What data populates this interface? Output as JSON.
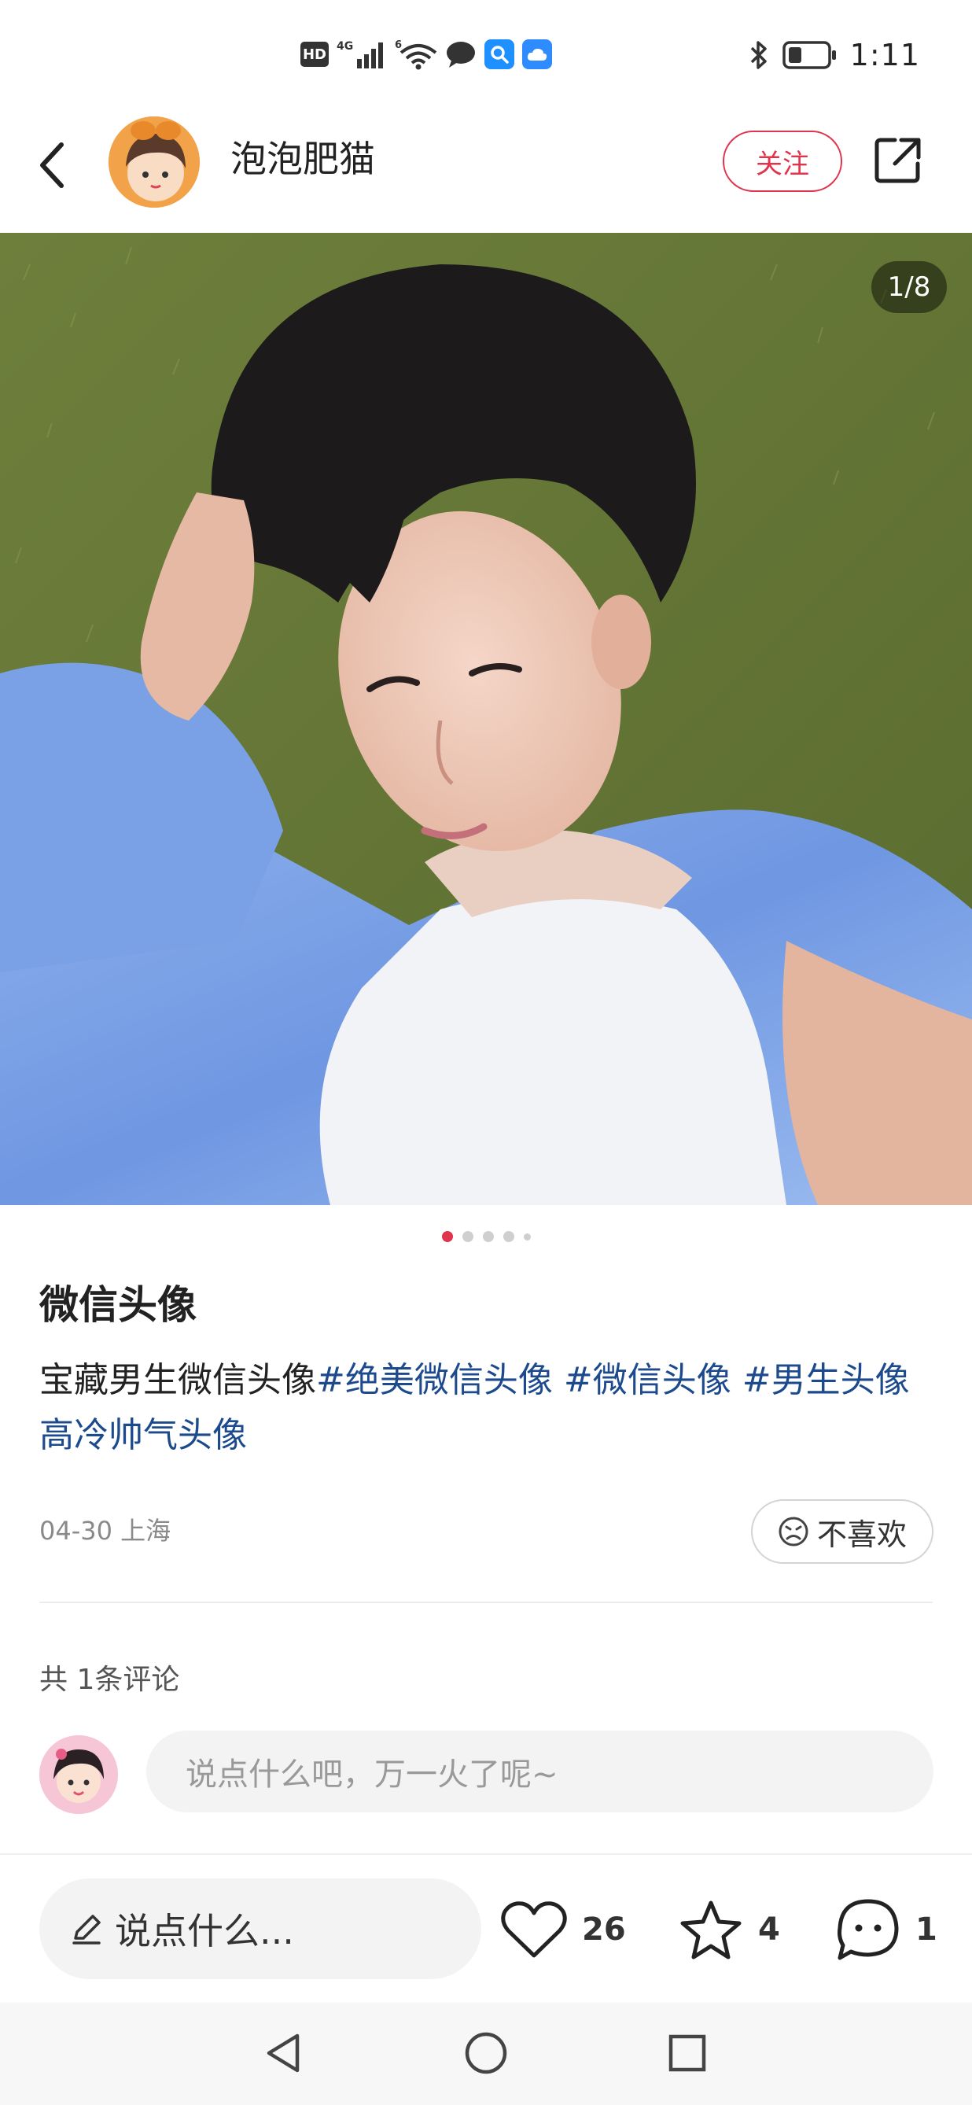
{
  "status_bar": {
    "hd_label": "HD",
    "network_label": "4G",
    "wifi_label": "6",
    "time": "1:11"
  },
  "header": {
    "author_name": "泡泡肥猫",
    "follow_label": "关注"
  },
  "photo": {
    "page_counter": "1/8",
    "current_index": 1,
    "total": 8
  },
  "post": {
    "title": "微信头像",
    "desc_text": "宝藏男生微信头像",
    "tags": [
      "#绝美微信头像",
      "#微信头像",
      "#男生头像高冷帅气头像"
    ],
    "meta": "04-30 上海",
    "dislike_label": "不喜欢"
  },
  "comments": {
    "count_label": "共 1条评论",
    "input_placeholder": "说点什么吧，万一火了呢~"
  },
  "actions": {
    "say_label": "说点什么...",
    "likes": "26",
    "favorites": "4",
    "comments": "1"
  },
  "colors": {
    "accent": "#e0334c",
    "tag": "#1c4a8c"
  }
}
